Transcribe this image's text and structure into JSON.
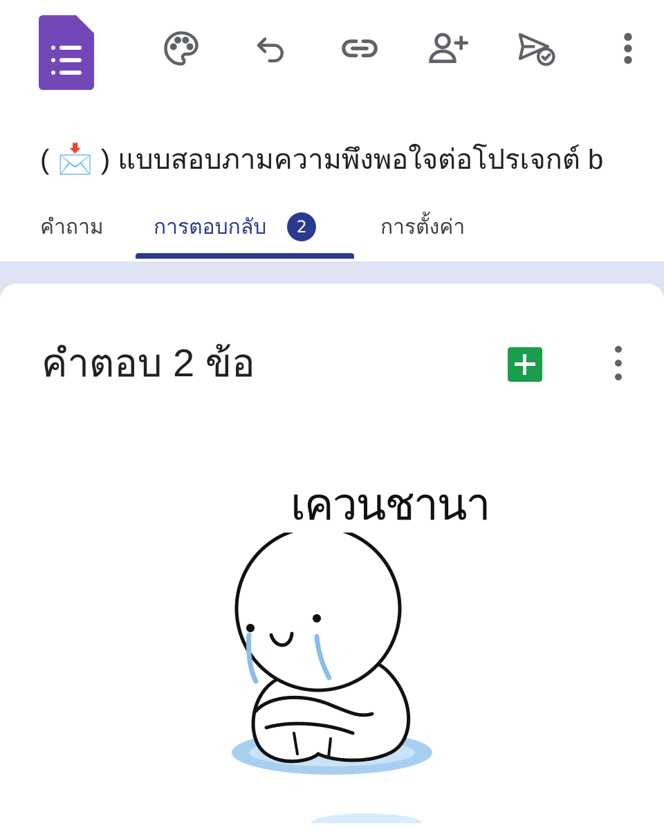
{
  "toolbar": {
    "icons": [
      "forms-logo",
      "palette-icon",
      "undo-icon",
      "link-icon",
      "add-collaborator-icon",
      "send-icon",
      "more-vert-icon"
    ]
  },
  "form": {
    "title_prefix": "( ",
    "title_emoji": "📩",
    "title_text": " ) แบบสอบภามความพึงพอใจต่อโปรเจกต์ b"
  },
  "tabs": [
    {
      "label": "คำถาม"
    },
    {
      "label": "การตอบกลับ",
      "badge": "2"
    },
    {
      "label": "การตั้งค่า"
    }
  ],
  "responses": {
    "heading": "คำตอบ 2 ข้อ"
  },
  "sticker": {
    "caption": "เควนชานา"
  },
  "colors": {
    "forms_purple": "#7248b9",
    "active_tab": "#2b3a8f",
    "sheets_green": "#1a9e4b",
    "band": "#dfe2f3"
  }
}
